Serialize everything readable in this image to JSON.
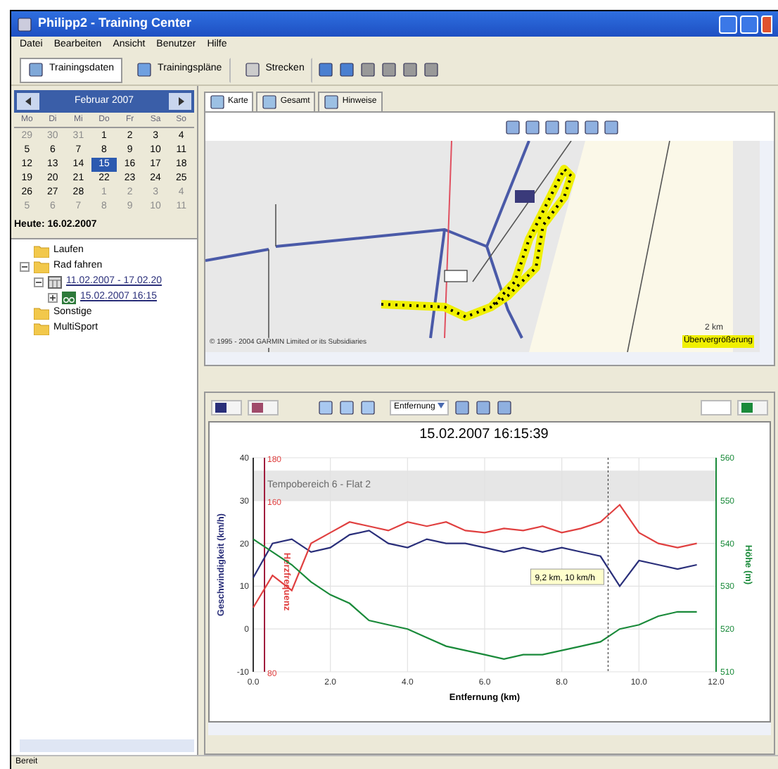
{
  "window": {
    "title": "Philipp2 - Training Center"
  },
  "menu": [
    "Datei",
    "Bearbeiten",
    "Ansicht",
    "Benutzer",
    "Hilfe"
  ],
  "toolbar": [
    {
      "label": "Trainingsdaten",
      "selected": true
    },
    {
      "label": "Trainingspläne",
      "selected": false
    },
    {
      "label": "Strecken",
      "selected": false
    }
  ],
  "calendar": {
    "month": "Februar 2007",
    "weekdays": [
      "Mo",
      "Di",
      "Mi",
      "Do",
      "Fr",
      "Sa",
      "So"
    ],
    "days": [
      {
        "d": "29",
        "other": true,
        "selected": false
      },
      {
        "d": "30",
        "other": true,
        "selected": false
      },
      {
        "d": "31",
        "other": true,
        "selected": false
      },
      {
        "d": "1",
        "other": false,
        "selected": false
      },
      {
        "d": "2",
        "other": false,
        "selected": false
      },
      {
        "d": "3",
        "other": false,
        "selected": false
      },
      {
        "d": "4",
        "other": false,
        "selected": false
      },
      {
        "d": "5",
        "other": false,
        "selected": false
      },
      {
        "d": "6",
        "other": false,
        "selected": false
      },
      {
        "d": "7",
        "other": false,
        "selected": false
      },
      {
        "d": "8",
        "other": false,
        "selected": false
      },
      {
        "d": "9",
        "other": false,
        "selected": false
      },
      {
        "d": "10",
        "other": false,
        "selected": false
      },
      {
        "d": "11",
        "other": false,
        "selected": false
      },
      {
        "d": "12",
        "other": false,
        "selected": false
      },
      {
        "d": "13",
        "other": false,
        "selected": false
      },
      {
        "d": "14",
        "other": false,
        "selected": false
      },
      {
        "d": "15",
        "other": false,
        "selected": true
      },
      {
        "d": "16",
        "other": false,
        "selected": false
      },
      {
        "d": "17",
        "other": false,
        "selected": false
      },
      {
        "d": "18",
        "other": false,
        "selected": false
      },
      {
        "d": "19",
        "other": false,
        "selected": false
      },
      {
        "d": "20",
        "other": false,
        "selected": false
      },
      {
        "d": "21",
        "other": false,
        "selected": false
      },
      {
        "d": "22",
        "other": false,
        "selected": false
      },
      {
        "d": "23",
        "other": false,
        "selected": false
      },
      {
        "d": "24",
        "other": false,
        "selected": false
      },
      {
        "d": "25",
        "other": false,
        "selected": false
      },
      {
        "d": "26",
        "other": false,
        "selected": false
      },
      {
        "d": "27",
        "other": false,
        "selected": false
      },
      {
        "d": "28",
        "other": false,
        "selected": false
      },
      {
        "d": "1",
        "other": true,
        "selected": false
      },
      {
        "d": "2",
        "other": true,
        "selected": false
      },
      {
        "d": "3",
        "other": true,
        "selected": false
      },
      {
        "d": "4",
        "other": true,
        "selected": false
      },
      {
        "d": "5",
        "other": true,
        "selected": false
      },
      {
        "d": "6",
        "other": true,
        "selected": false
      },
      {
        "d": "7",
        "other": true,
        "selected": false
      },
      {
        "d": "8",
        "other": true,
        "selected": false
      },
      {
        "d": "9",
        "other": true,
        "selected": false
      },
      {
        "d": "10",
        "other": true,
        "selected": false
      },
      {
        "d": "11",
        "other": true,
        "selected": false
      }
    ],
    "today": "Heute: 16.02.2007"
  },
  "tree": [
    {
      "label": "Laufen",
      "kind": "folder"
    },
    {
      "label": "Rad fahren",
      "kind": "folder",
      "expanded": true,
      "children": [
        {
          "label": "11.02.2007 - 17.02.20",
          "kind": "week",
          "expanded": true,
          "children": [
            {
              "label": "15.02.2007 16:15",
              "kind": "activity",
              "expanded": false
            }
          ]
        }
      ]
    },
    {
      "label": "Sonstige",
      "kind": "folder"
    },
    {
      "label": "MultiSport",
      "kind": "folder"
    }
  ],
  "tabs": [
    {
      "label": "Karte",
      "selected": true
    },
    {
      "label": "Gesamt",
      "selected": false
    },
    {
      "label": "Hinweise",
      "selected": false
    }
  ],
  "map": {
    "copyright": "© 1995 - 2004 GARMIN Limited or its Subsidiaries",
    "scale": "2 km",
    "zoom_note": "Übervergrößerung"
  },
  "chart_toolbar": {
    "axis_select": "Entfernung"
  },
  "chart": {
    "chart_data": {
      "type": "line",
      "title": "15.02.2007 16:15:39",
      "xlabel": "Entfernung (km)",
      "ylabel": "Geschwindigkeit (km/h)",
      "y2label": "Herzfrequenz",
      "y3label": "Höhe (m)",
      "grid": true,
      "bands": [
        {
          "axis": "y",
          "from": 30,
          "to": 37,
          "label": "Tempobereich 6 - Flat 2"
        }
      ],
      "ref_lines": [
        {
          "axis": "x",
          "value": 9.2
        }
      ],
      "annotations": [
        "9,2 km, 10 km/h"
      ],
      "y2lim": [
        80,
        180
      ],
      "y2ticks": [
        180,
        160,
        80
      ],
      "y3lim": [
        510,
        560
      ],
      "y3ticks": [
        560,
        550,
        540,
        530,
        520,
        510
      ],
      "x": [
        0,
        0.5,
        1,
        1.5,
        2,
        2.5,
        3,
        3.5,
        4,
        4.5,
        5,
        5.5,
        6,
        6.5,
        7,
        7.5,
        8,
        8.5,
        9,
        9.5,
        10,
        10.5,
        11,
        11.5
      ],
      "series": [
        {
          "color": "#2a2f7a",
          "values": [
            12,
            20,
            21,
            18,
            19,
            22,
            23,
            20,
            19,
            21,
            20,
            20,
            19,
            18,
            19,
            18,
            19,
            18,
            17,
            10,
            16,
            15,
            14,
            15
          ]
        },
        {
          "color": "#e04040",
          "axis": "y2",
          "values": [
            110,
            125,
            118,
            140,
            145,
            150,
            148,
            146,
            150,
            148,
            150,
            146,
            145,
            147,
            146,
            148,
            145,
            147,
            150,
            158,
            145,
            140,
            138,
            140
          ]
        },
        {
          "color": "#1a8a3a",
          "axis": "y3",
          "values": [
            541,
            538,
            535,
            531,
            528,
            526,
            522,
            521,
            520,
            518,
            516,
            515,
            514,
            513,
            514,
            514,
            515,
            516,
            517,
            520,
            521,
            523,
            524,
            524
          ]
        }
      ],
      "xlim": [
        0,
        12
      ],
      "ylim": [
        -10,
        40
      ],
      "xticks": [
        {
          "value": 0,
          "label": "0.0"
        },
        {
          "value": 2,
          "label": "2.0"
        },
        {
          "value": 4,
          "label": "4.0"
        },
        {
          "value": 6,
          "label": "6.0"
        },
        {
          "value": 8,
          "label": "8.0"
        },
        {
          "value": 10,
          "label": "10.0"
        },
        {
          "value": 12,
          "label": "12.0"
        }
      ],
      "yticks": [
        40,
        30,
        20,
        10,
        0,
        -10
      ]
    }
  },
  "status_bar": "Bereit"
}
